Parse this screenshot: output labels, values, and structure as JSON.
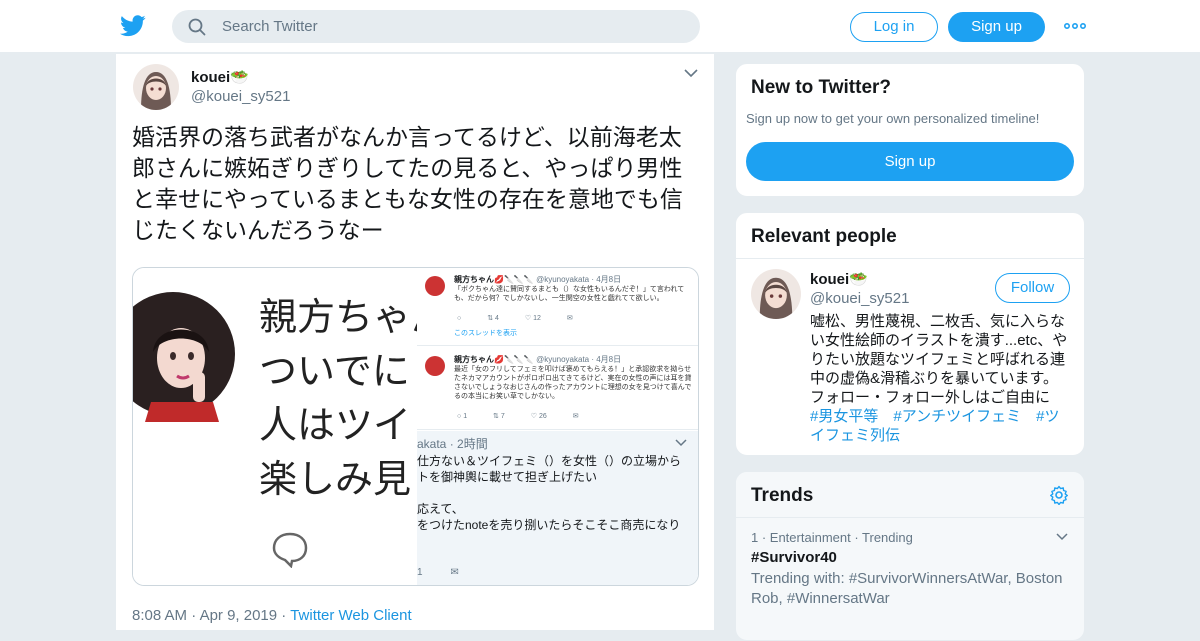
{
  "colors": {
    "accent": "#1da1f2",
    "link": "#1b95e0",
    "secondary_text": "#657786",
    "background": "#e6ecf0"
  },
  "header": {
    "logo_icon": "twitter-bird-icon",
    "search_placeholder": "Search Twitter",
    "login_label": "Log in",
    "signup_label": "Sign up",
    "more_icon": "more-dots-icon"
  },
  "tweet": {
    "author_name": "kouei🥗",
    "author_handle": "@kouei_sy521",
    "text": "婚活界の落ち武者がなんか言ってるけど、以前海老太郎さんに嫉妬ぎりぎりしてたの見ると、やっぱり男性と幸せにやっているまともな女性の存在を意地でも信じたくないんだろうなー",
    "media": {
      "left_lines": [
        "親方ちゃん",
        "ついでに",
        "人はツイ",
        "楽しみ見"
      ],
      "mini_tweets": [
        {
          "name": "親方ちゃん💋🔪🔪🔪",
          "meta": "@kyunoyakata · 4月8日",
          "text": "「ボクちゃん達に賛同するまとも（）な女性もいるんだぞ！」て言われても、だから何？でしかないし、一生関空の女性と戯れてて欲しい。",
          "actions": [
            "",
            "4",
            "12",
            ""
          ],
          "link": "このスレッドを表示"
        },
        {
          "name": "親方ちゃん💋🔪🔪🔪",
          "meta": "@kyunoyakata · 4月8日",
          "text": "最近「女のフリしてフェミを叩けば褒めてもらえる！」と承認欲求を拗らせたネカマアカウントがポロポロ出てきてるけど、実在の女性の声には耳を貸さないでしょうなおじさんの作ったアカウントに理想の女を見つけて喜んでるの本当にお笑い草でしかない。",
          "actions": [
            "1",
            "7",
            "26",
            ""
          ]
        }
      ],
      "zoom_head": "akata · 2時間",
      "zoom_lines": [
        "仕方ない＆ツイフェミ（）を女性（）の立場から",
        "トを御神輿に載せて担ぎ上げたい",
        "",
        "応えて、",
        "をつけたnoteを売り捌いたらそこそこ商売になり"
      ],
      "zoom_icons": "1"
    },
    "time": "8:08 AM",
    "date": "Apr 9, 2019",
    "client": "Twitter Web Client"
  },
  "sidebar": {
    "new_to_twitter": {
      "title": "New to Twitter?",
      "subtitle": "Sign up now to get your own personalized timeline!",
      "signup_label": "Sign up"
    },
    "relevant_people": {
      "title": "Relevant people",
      "name": "kouei🥗",
      "handle": "@kouei_sy521",
      "follow_label": "Follow",
      "bio_text": "嘘松、男性蔑視、二枚舌、気に入らない女性絵師のイラストを潰す...etc、やりたい放題なツイフェミと呼ばれる連中の虚偽&滑稽ぶりを暴いています。フォロー・フォロー外しはご自由に　",
      "tag1": "#男女平等",
      "tag2": "#アンチツイフェミ",
      "tag3": "#ツイフェミ列伝"
    },
    "trends": {
      "title": "Trends",
      "items": [
        {
          "meta": "1 · Entertainment · Trending",
          "name": "#Survivor40",
          "with": "Trending with: #SurvivorWinnersAtWar, Boston Rob, #WinnersatWar"
        }
      ]
    }
  }
}
